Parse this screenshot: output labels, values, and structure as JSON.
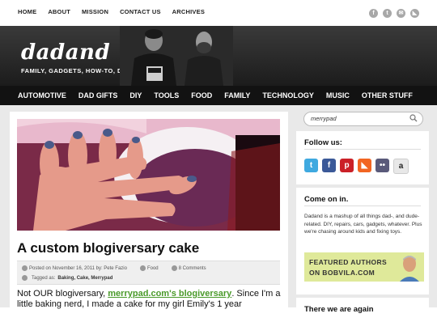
{
  "topnav": {
    "items": [
      "HOME",
      "ABOUT",
      "MISSION",
      "CONTACT US",
      "ARCHIVES"
    ]
  },
  "social_icons": [
    "facebook-icon",
    "twitter-icon",
    "email-icon",
    "rss-icon"
  ],
  "header": {
    "logo": "dadand",
    "tagline": "FAMILY, GADGETS, HOW-TO, DIY"
  },
  "mainnav": {
    "items": [
      "AUTOMOTIVE",
      "DAD GIFTS",
      "DIY",
      "TOOLS",
      "FOOD",
      "FAMILY",
      "TECHNOLOGY",
      "MUSIC",
      "OTHER STUFF"
    ]
  },
  "post": {
    "title": "A custom blogiversary cake",
    "posted_on": "Posted on November 16, 2011 by: Pete Fazio",
    "category": "Food",
    "comments": "8 Comments",
    "tagged_label": "Tagged as:",
    "tags": "Baking, Cake, Merrypad",
    "body_start": "Not OUR blogiversary, ",
    "body_link": "merrypad.com's blogiversary",
    "body_rest": ". Since I'm a little baking nerd, I made a cake for my girl Emily's 1 year"
  },
  "sidebar": {
    "search_value": "merrypad",
    "follow_title": "Follow us:",
    "follow_icons": [
      {
        "name": "twitter-icon",
        "glyph": "t",
        "color": "#3fa9e0"
      },
      {
        "name": "facebook-icon",
        "glyph": "f",
        "color": "#3b5998"
      },
      {
        "name": "pinterest-icon",
        "glyph": "p",
        "color": "#cb2027"
      },
      {
        "name": "rss-icon",
        "glyph": "◣",
        "color": "#f26522"
      },
      {
        "name": "flickr-icon",
        "glyph": "••",
        "color": "#5a5a7a"
      },
      {
        "name": "amazon-icon",
        "glyph": "a",
        "color": "#e8e8e8"
      }
    ],
    "comein_title": "Come on in.",
    "comein_text": "Dadand is a mashup of all things dad-, and dude-related. DIY, repairs, cars, gadgets, whatever. Plus we're chasing around kids and fixing toys.",
    "banner_line1": "FEATURED AUTHORS",
    "banner_line2": "ON BOBVILA.COM",
    "next_title": "There we are again"
  }
}
